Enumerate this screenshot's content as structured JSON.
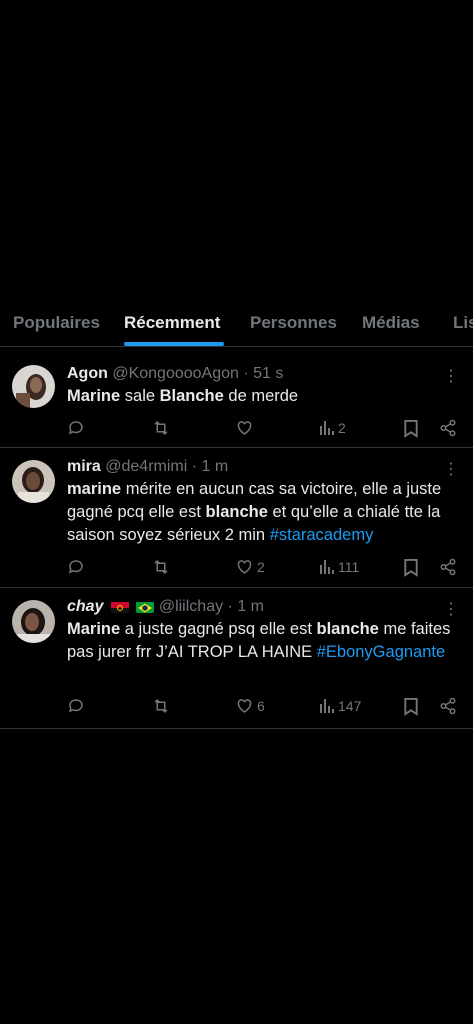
{
  "tabs": [
    "Populaires",
    "Récemment",
    "Personnes",
    "Médias",
    "Lis"
  ],
  "active_tab": "Récemment",
  "tweets": [
    {
      "name": "Agon",
      "handle": "@KongooooAgon",
      "time": "· 51 s",
      "body": {
        "w1": "Marine",
        "t1": " sale ",
        "w2": "Blanche",
        "t2": " de merde"
      },
      "likes": "",
      "views": "2"
    },
    {
      "name": "mira",
      "handle": "@de4rmimi",
      "time": "· 1 m",
      "body": {
        "w1": "marine",
        "t1": " mérite en aucun cas sa victoire, elle a juste gagné pcq elle est ",
        "w2": "blanche",
        "t2": " et qu’elle a chialé tte la saison soyez sérieux 2 min ",
        "hashtag": "#staracademy"
      },
      "likes": "2",
      "views": "111"
    },
    {
      "name": "chay",
      "handle": "@liilchay",
      "time": "· 1 m",
      "body": {
        "w1": "Marine",
        "t1": " a juste gagné psq elle est ",
        "w2": "blanche",
        "t2": " me faites pas jurer frr J’AI TROP LA HAINE ",
        "hashtag": "#EbonyGagnante"
      },
      "likes": "6",
      "views": "147"
    }
  ],
  "more_glyph": "⋮",
  "colors": {
    "accent": "#1d9bf0",
    "muted": "#71767b",
    "text": "#e7e9ea",
    "divider": "#2f3336"
  }
}
